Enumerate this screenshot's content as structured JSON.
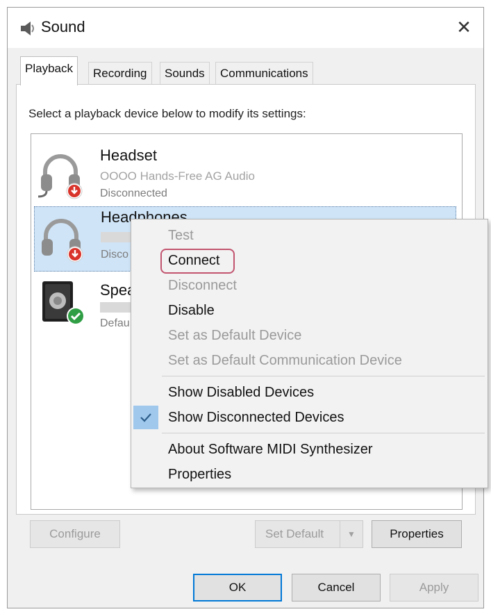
{
  "window": {
    "title": "Sound",
    "close_glyph": "✕"
  },
  "tabs": [
    {
      "label": "Playback",
      "active": true
    },
    {
      "label": "Recording",
      "active": false
    },
    {
      "label": "Sounds",
      "active": false
    },
    {
      "label": "Communications",
      "active": false
    }
  ],
  "panel": {
    "instruction": "Select a playback device below to modify its settings:"
  },
  "devices": [
    {
      "name": "Headset",
      "description": "OOOO Hands-Free AG Audio",
      "status": "Disconnected",
      "icon": "headset-icon",
      "badge": "disconnected-badge-icon"
    },
    {
      "name": "Headphones",
      "description": "",
      "status": "Disco",
      "icon": "headphones-icon",
      "badge": "disconnected-badge-icon",
      "selected": true
    },
    {
      "name": "Spea",
      "description": "",
      "status": "Defau",
      "icon": "speaker-icon",
      "badge": "default-check-badge-icon"
    }
  ],
  "context_menu": {
    "items": [
      {
        "label": "Test",
        "enabled": false
      },
      {
        "label": "Connect",
        "enabled": true,
        "highlighted": true
      },
      {
        "label": "Disconnect",
        "enabled": false
      },
      {
        "label": "Disable",
        "enabled": true
      },
      {
        "label": "Set as Default Device",
        "enabled": false
      },
      {
        "label": "Set as Default Communication Device",
        "enabled": false
      },
      {
        "label": "Show Disabled Devices",
        "enabled": true
      },
      {
        "label": "Show Disconnected Devices",
        "enabled": true,
        "checked": true
      },
      {
        "label": "About Software MIDI Synthesizer",
        "enabled": true
      },
      {
        "label": "Properties",
        "enabled": true
      }
    ]
  },
  "panel_buttons": {
    "configure": "Configure",
    "set_default": "Set Default",
    "properties": "Properties"
  },
  "footer_buttons": {
    "ok": "OK",
    "cancel": "Cancel",
    "apply": "Apply"
  },
  "colors": {
    "selection": "#cfe4f7",
    "check_highlight": "#9fc8ec",
    "connect_ring": "#c2546f",
    "disconnected_red": "#d9342b",
    "default_green": "#2f9e44"
  }
}
